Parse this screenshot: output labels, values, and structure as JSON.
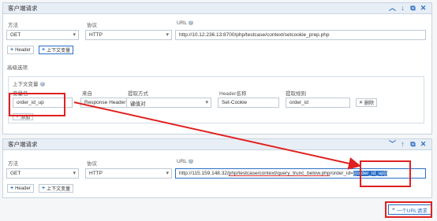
{
  "panel1": {
    "title": "客户端请求",
    "labels": {
      "method": "方法",
      "protocol": "协议",
      "url": "URL"
    },
    "method": "GET",
    "protocol": "HTTP",
    "url": "http://10.12.236.13:8700/php/testcase/context/setcookie_prep.php",
    "header_btn": "Header",
    "context_btn": "上下文变量",
    "advanced": "高级选项",
    "context_section": {
      "title": "上下文变量",
      "headers": {
        "var_name": "变量名",
        "source": "来自",
        "extract": "提取方式",
        "header_name": "Header名称",
        "rule": "提取规则"
      },
      "row": {
        "var_name": "order_id_up",
        "source": "Response Header",
        "extract": "键值对",
        "header_name": "Set-Cookie",
        "rule": "order_id",
        "delete": "删除"
      },
      "add": "添加"
    }
  },
  "panel2": {
    "title": "客户端请求",
    "labels": {
      "method": "方法",
      "protocol": "协议",
      "url": "URL"
    },
    "method": "GET",
    "protocol": "HTTP",
    "url_prefix": "http://115.159.148.32/",
    "url_mid": "php/testcase/context/query_trunc_below.php",
    "url_query": "/order_id=",
    "url_var": "{{order_id_up}}",
    "header_btn": "Header",
    "context_btn": "上下文变量"
  },
  "add_url_btn": "一个URL请求",
  "colors": {
    "accent": "#2a6fc8",
    "highlight": "#e02020"
  },
  "icons": [
    "chevron-up-icon",
    "arrow-down-icon",
    "copy-icon",
    "close-icon",
    "arrow-up-icon",
    "info-icon",
    "plus-icon"
  ]
}
